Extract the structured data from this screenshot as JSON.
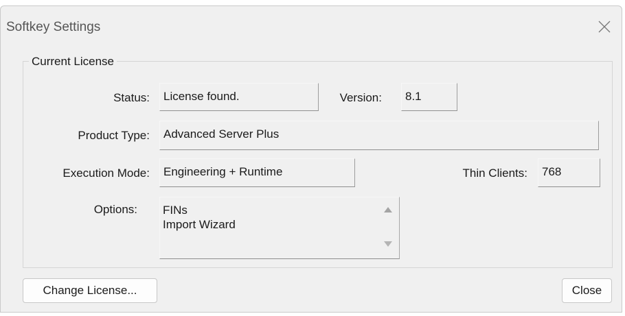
{
  "window": {
    "title": "Softkey Settings",
    "close_icon": "close-icon"
  },
  "current_license": {
    "group_label": "Current License",
    "status_label": "Status:",
    "status_value": "License found.",
    "version_label": "Version:",
    "version_value": "8.1",
    "product_type_label": "Product Type:",
    "product_type_value": "Advanced Server Plus",
    "execution_mode_label": "Execution Mode:",
    "execution_mode_value": "Engineering + Runtime",
    "thin_clients_label": "Thin Clients:",
    "thin_clients_value": "768",
    "options_label": "Options:",
    "options_items": [
      "FINs",
      "Import Wizard"
    ]
  },
  "buttons": {
    "change_license": "Change License...",
    "close": "Close"
  }
}
